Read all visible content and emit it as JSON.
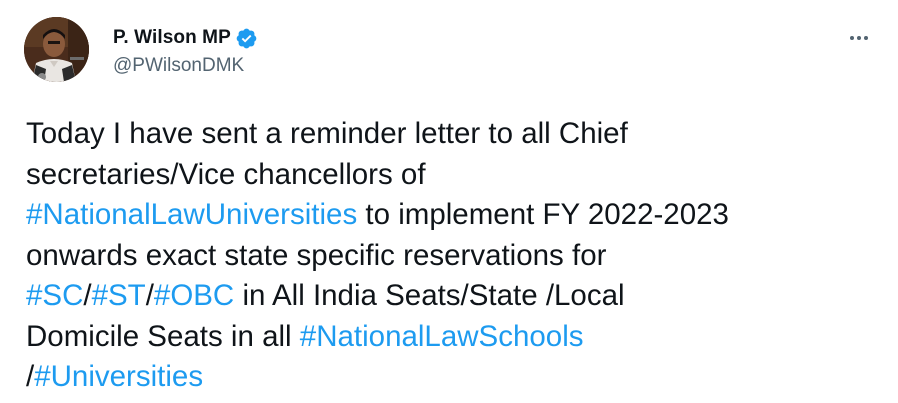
{
  "colors": {
    "accent": "#1d9bf0",
    "text": "#0f1419",
    "muted": "#536471"
  },
  "author": {
    "display_name": "P. Wilson MP",
    "handle": "@PWilsonDMK",
    "verified_icon": "verified-badge-icon",
    "avatar_icon": "profile-photo"
  },
  "menu": {
    "more_icon": "more-options-icon"
  },
  "tweet": {
    "l1": "Today I have sent a reminder letter to all Chief",
    "l2": "secretaries/Vice chancellors of",
    "l3_tag": "#NationalLawUniversities",
    "l3_rest": " to implement FY 2022-2023",
    "l4": "onwards exact state specific reservations for",
    "l5_tag1": "#SC",
    "l5_sep1": "/",
    "l5_tag2": "#ST",
    "l5_sep2": "/",
    "l5_tag3": "#OBC",
    "l5_rest": " in All India Seats/State /Local",
    "l6_text": "Domicile Seats in all ",
    "l6_tag": "#NationalLawSchools",
    "l7_sep": "/",
    "l7_tag": "#Universities"
  }
}
